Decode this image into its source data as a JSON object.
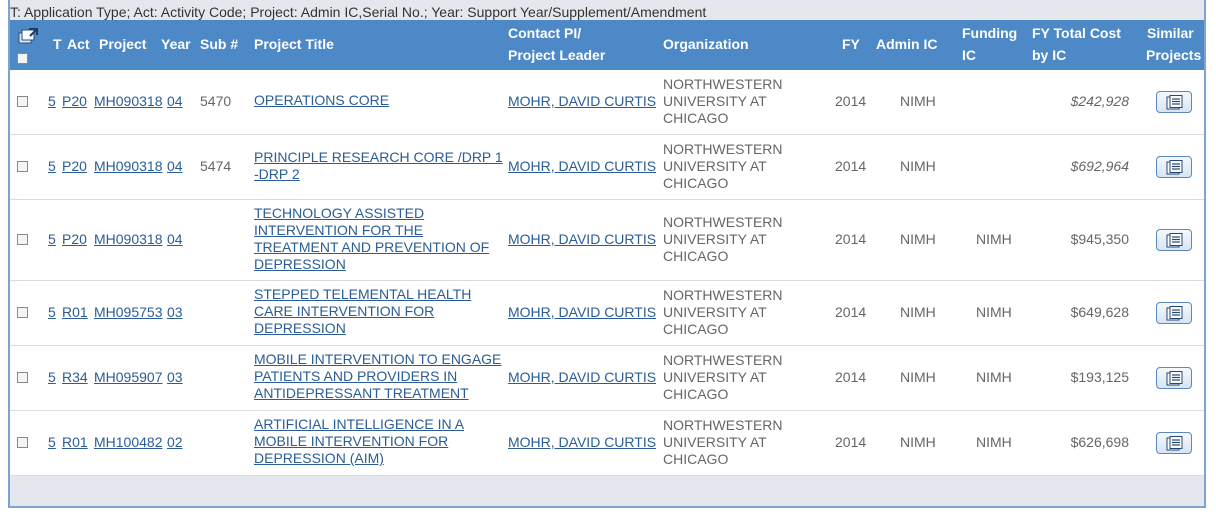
{
  "legend": "T: Application Type; Act: Activity Code; Project: Admin IC,Serial No.; Year: Support Year/Supplement/Amendment",
  "headers": {
    "t": "T",
    "act": "Act",
    "project": "Project",
    "year": "Year",
    "sub": "Sub #",
    "title": "Project Title",
    "pi_line1": "Contact PI/",
    "pi_line2": "Project Leader",
    "org": "Organization",
    "fy": "FY",
    "admin_ic": "Admin IC",
    "funding_line1": "Funding",
    "funding_line2": "IC",
    "cost_line1": "FY Total Cost",
    "cost_line2": "by IC",
    "similar_line1": "Similar",
    "similar_line2": "Projects"
  },
  "header_icon": "export-icon",
  "rows": [
    {
      "t": "5",
      "act": "P20",
      "project": "MH090318",
      "year": "04",
      "sub": "5470",
      "title": [
        "OPERATIONS CORE"
      ],
      "pi": "MOHR, DAVID CURTIS",
      "org": [
        "NORTHWESTERN",
        "UNIVERSITY AT",
        "CHICAGO"
      ],
      "fy": "2014",
      "admin_ic": "NIMH",
      "funding_ic": "",
      "cost": "$242,928",
      "cost_italic": true
    },
    {
      "t": "5",
      "act": "P20",
      "project": "MH090318",
      "year": "04",
      "sub": "5474",
      "title": [
        "PRINCIPLE RESEARCH CORE /DRP 1",
        "-DRP 2"
      ],
      "pi": "MOHR, DAVID CURTIS",
      "org": [
        "NORTHWESTERN",
        "UNIVERSITY AT",
        "CHICAGO"
      ],
      "fy": "2014",
      "admin_ic": "NIMH",
      "funding_ic": "",
      "cost": "$692,964",
      "cost_italic": true
    },
    {
      "t": "5",
      "act": "P20",
      "project": "MH090318",
      "year": "04",
      "sub": "",
      "title": [
        "TECHNOLOGY ASSISTED",
        "INTERVENTION FOR THE",
        "TREATMENT AND PREVENTION OF",
        "DEPRESSION"
      ],
      "pi": "MOHR, DAVID CURTIS",
      "org": [
        "NORTHWESTERN",
        "UNIVERSITY AT",
        "CHICAGO"
      ],
      "fy": "2014",
      "admin_ic": "NIMH",
      "funding_ic": "NIMH",
      "cost": "$945,350",
      "cost_italic": false
    },
    {
      "t": "5",
      "act": "R01",
      "project": "MH095753",
      "year": "03",
      "sub": "",
      "title": [
        "STEPPED TELEMENTAL HEALTH",
        "CARE INTERVENTION FOR",
        "DEPRESSION"
      ],
      "pi": "MOHR, DAVID CURTIS",
      "org": [
        "NORTHWESTERN",
        "UNIVERSITY AT",
        "CHICAGO"
      ],
      "fy": "2014",
      "admin_ic": "NIMH",
      "funding_ic": "NIMH",
      "cost": "$649,628",
      "cost_italic": false
    },
    {
      "t": "5",
      "act": "R34",
      "project": "MH095907",
      "year": "03",
      "sub": "",
      "title": [
        "MOBILE INTERVENTION TO ENGAGE",
        "PATIENTS AND PROVIDERS IN",
        "ANTIDEPRESSANT TREATMENT"
      ],
      "pi": "MOHR, DAVID CURTIS",
      "org": [
        "NORTHWESTERN",
        "UNIVERSITY AT",
        "CHICAGO"
      ],
      "fy": "2014",
      "admin_ic": "NIMH",
      "funding_ic": "NIMH",
      "cost": "$193,125",
      "cost_italic": false
    },
    {
      "t": "5",
      "act": "R01",
      "project": "MH100482",
      "year": "02",
      "sub": "",
      "title": [
        "ARTIFICIAL INTELLIGENCE IN A",
        "MOBILE INTERVENTION FOR",
        "DEPRESSION (AIM)"
      ],
      "pi": "MOHR, DAVID CURTIS",
      "org": [
        "NORTHWESTERN",
        "UNIVERSITY AT",
        "CHICAGO"
      ],
      "fy": "2014",
      "admin_ic": "NIMH",
      "funding_ic": "NIMH",
      "cost": "$626,698",
      "cost_italic": false
    }
  ],
  "similar_icon": "similar-projects-icon"
}
